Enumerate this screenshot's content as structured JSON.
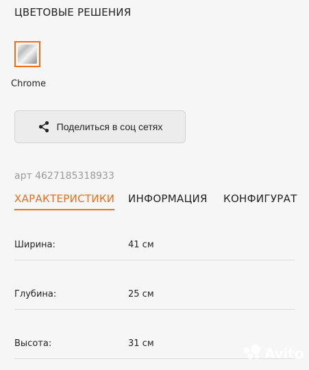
{
  "colors": {
    "accent": "#f26b16",
    "muted_text": "#9a9a9a",
    "button_bg": "#ececec",
    "divider": "#d9d9d9"
  },
  "color_section": {
    "title": "ЦВЕТОВЫЕ РЕШЕНИЯ",
    "selected_swatch_label": "Chrome",
    "swatch_icon": "chrome-swatch-icon"
  },
  "share": {
    "label": "Поделиться в соц сетях",
    "icon": "share-icon"
  },
  "article": {
    "text": "арт 4627185318933"
  },
  "tabs": [
    {
      "label": "ХАРАКТЕРИСТИКИ",
      "active": true
    },
    {
      "label": "ИНФОРМАЦИЯ",
      "active": false
    },
    {
      "label": "КОНФИГУРАТ",
      "active": false
    }
  ],
  "specs": [
    {
      "label": "Ширина:",
      "value": "41 см"
    },
    {
      "label": "Глубина:",
      "value": "25 см"
    },
    {
      "label": "Высота:",
      "value": "31 см"
    }
  ],
  "watermark": {
    "text": "Avito",
    "icon": "avito-logo-icon"
  }
}
